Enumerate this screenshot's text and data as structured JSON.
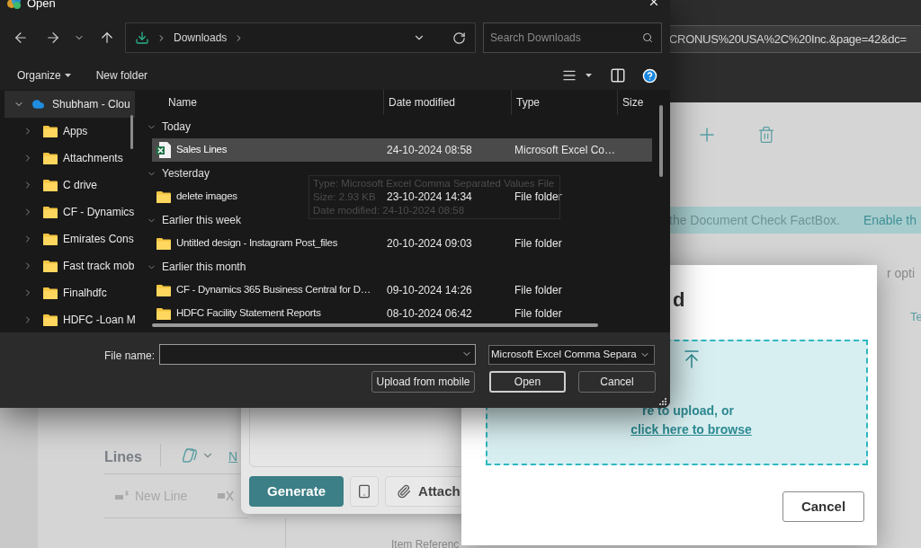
{
  "browser": {
    "address_tail": "CRONUS%20USA%2C%20Inc.&page=42&dc="
  },
  "page": {
    "banner": {
      "message": "the Document Check FactBox.",
      "action": "Enable th"
    },
    "side_text": "r opti",
    "tab_text": "Te",
    "lines": {
      "title": "Lines",
      "tab": "N",
      "action": "New Line"
    },
    "column_text": "Item Referenc"
  },
  "copilot": {
    "buttons": [
      {
        "kind": "primary",
        "label": "Generate"
      },
      {
        "kind": "icon"
      },
      {
        "kind": "attach",
        "label": "Attach"
      }
    ]
  },
  "upload_dialog": {
    "title": "d",
    "drop_text": "re to upload, or",
    "browse_link": "click here to browse",
    "cancel": "Cancel"
  },
  "open_dialog": {
    "title": "Open",
    "address": {
      "folder": "Downloads"
    },
    "search": {
      "placeholder": "Search Downloads"
    },
    "toolbar": {
      "organize": "Organize",
      "new_folder": "New folder"
    },
    "tree": {
      "label": "Shubham - Clou",
      "expanded": true,
      "selected": true,
      "children": [
        {
          "label": "Apps",
          "expanded": false,
          "selected": false
        },
        {
          "label": "Attachments",
          "expanded": false,
          "selected": false
        },
        {
          "label": "C drive",
          "expanded": false,
          "selected": false
        },
        {
          "label": "CF - Dynamics",
          "expanded": false,
          "selected": false
        },
        {
          "label": "Emirates Cons",
          "expanded": false,
          "selected": false
        },
        {
          "label": "Fast track mob",
          "expanded": false,
          "selected": false
        },
        {
          "label": "Finalhdfc",
          "expanded": false,
          "selected": false
        },
        {
          "label": "HDFC -Loan M",
          "expanded": false,
          "selected": false
        }
      ]
    },
    "columns": [
      "Name",
      "Date modified",
      "Type",
      "Size"
    ],
    "groups": [
      {
        "label": "Today",
        "expanded": true,
        "items": [
          {
            "kind": "excel",
            "name": "Sales Lines",
            "date": "24-10-2024 08:58",
            "type": "Microsoft Excel Co…",
            "selected": true
          }
        ]
      },
      {
        "label": "Yesterday",
        "expanded": true,
        "items": [
          {
            "kind": "folder",
            "name": "delete images",
            "date": "23-10-2024 14:34",
            "type": "File folder",
            "selected": false
          }
        ]
      },
      {
        "label": "Earlier this week",
        "expanded": true,
        "items": [
          {
            "kind": "folder",
            "name": "Untitled design - Instagram Post_files",
            "date": "20-10-2024 09:03",
            "type": "File folder",
            "selected": false
          }
        ]
      },
      {
        "label": "Earlier this month",
        "expanded": true,
        "items": [
          {
            "kind": "folder",
            "name": "CF - Dynamics 365 Business Central for D…",
            "date": "09-10-2024 14:26",
            "type": "File folder",
            "selected": false
          },
          {
            "kind": "folder",
            "name": "HDFC Facility Statement Reports",
            "date": "08-10-2024 06:42",
            "type": "File folder",
            "selected": false
          }
        ]
      }
    ],
    "tooltip": [
      "Type: Microsoft Excel Comma Separated Values File",
      "Size: 2.93 KB",
      "Date modified: 24-10-2024 08:58"
    ],
    "file_name_label": "File name:",
    "file_type": "Microsoft Excel Comma Separa",
    "buttons": [
      {
        "kind": "plain",
        "label": "Upload from mobile"
      },
      {
        "kind": "default",
        "label": "Open"
      },
      {
        "kind": "plain",
        "label": "Cancel"
      }
    ]
  }
}
